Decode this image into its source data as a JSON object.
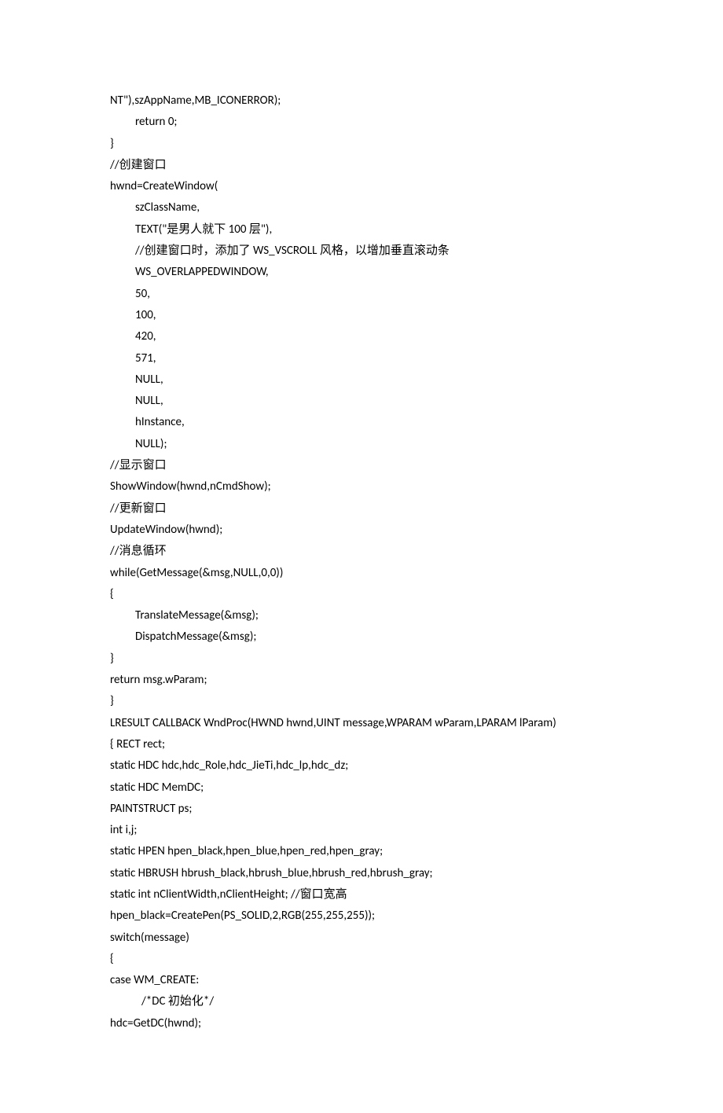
{
  "lines": [
    {
      "text": "NT\"),szAppName,MB_ICONERROR);",
      "indent": 0
    },
    {
      "text": "return 0;",
      "indent": 1
    },
    {
      "text": "}",
      "indent": 0
    },
    {
      "text": "//创建窗口",
      "indent": 0
    },
    {
      "text": "hwnd=CreateWindow(",
      "indent": 0
    },
    {
      "text": "szClassName,",
      "indent": 1
    },
    {
      "text": "TEXT(\"是男人就下 100 层\"),",
      "indent": 1
    },
    {
      "text": "//创建窗口时，添加了 WS_VSCROLL 风格，以增加垂直滚动条",
      "indent": 1
    },
    {
      "text": "WS_OVERLAPPEDWINDOW,",
      "indent": 1
    },
    {
      "text": "50,",
      "indent": 1
    },
    {
      "text": "100,",
      "indent": 1
    },
    {
      "text": "420,",
      "indent": 1
    },
    {
      "text": "571,",
      "indent": 1
    },
    {
      "text": "NULL,",
      "indent": 1
    },
    {
      "text": "NULL,",
      "indent": 1
    },
    {
      "text": "hInstance,",
      "indent": 1
    },
    {
      "text": "NULL);",
      "indent": 1
    },
    {
      "text": "//显示窗口",
      "indent": 0
    },
    {
      "text": "ShowWindow(hwnd,nCmdShow);",
      "indent": 0
    },
    {
      "text": "//更新窗口",
      "indent": 0
    },
    {
      "text": "UpdateWindow(hwnd);",
      "indent": 0
    },
    {
      "text": "//消息循环",
      "indent": 0
    },
    {
      "text": "while(GetMessage(&msg,NULL,0,0))",
      "indent": 0
    },
    {
      "text": "{",
      "indent": 0
    },
    {
      "text": "TranslateMessage(&msg);",
      "indent": 1
    },
    {
      "text": "DispatchMessage(&msg);",
      "indent": 1
    },
    {
      "text": "}",
      "indent": 0
    },
    {
      "text": "return msg.wParam;",
      "indent": 0
    },
    {
      "text": "}",
      "indent": 0
    },
    {
      "text": "LRESULT CALLBACK WndProc(HWND hwnd,UINT message,WPARAM wParam,LPARAM lParam)",
      "indent": 0
    },
    {
      "text": "{ RECT rect;",
      "indent": 0
    },
    {
      "text": "static HDC hdc,hdc_Role,hdc_JieTi,hdc_lp,hdc_dz;",
      "indent": 0
    },
    {
      "text": "static HDC MemDC;",
      "indent": 0
    },
    {
      "text": "PAINTSTRUCT ps;",
      "indent": 0
    },
    {
      "text": "int i,j;",
      "indent": 0
    },
    {
      "text": "static HPEN hpen_black,hpen_blue,hpen_red,hpen_gray;",
      "indent": 0
    },
    {
      "text": "static HBRUSH hbrush_black,hbrush_blue,hbrush_red,hbrush_gray;",
      "indent": 0
    },
    {
      "text": "static int nClientWidth,nClientHeight; //窗口宽高",
      "indent": 0
    },
    {
      "text": "hpen_black=CreatePen(PS_SOLID,2,RGB(255,255,255));",
      "indent": 0
    },
    {
      "text": "switch(message)",
      "indent": 0
    },
    {
      "text": "{",
      "indent": 0
    },
    {
      "text": "case WM_CREATE:",
      "indent": 0
    },
    {
      "text": "/*DC 初始化*/",
      "indent": 2
    },
    {
      "text": "hdc=GetDC(hwnd);",
      "indent": 0
    }
  ]
}
